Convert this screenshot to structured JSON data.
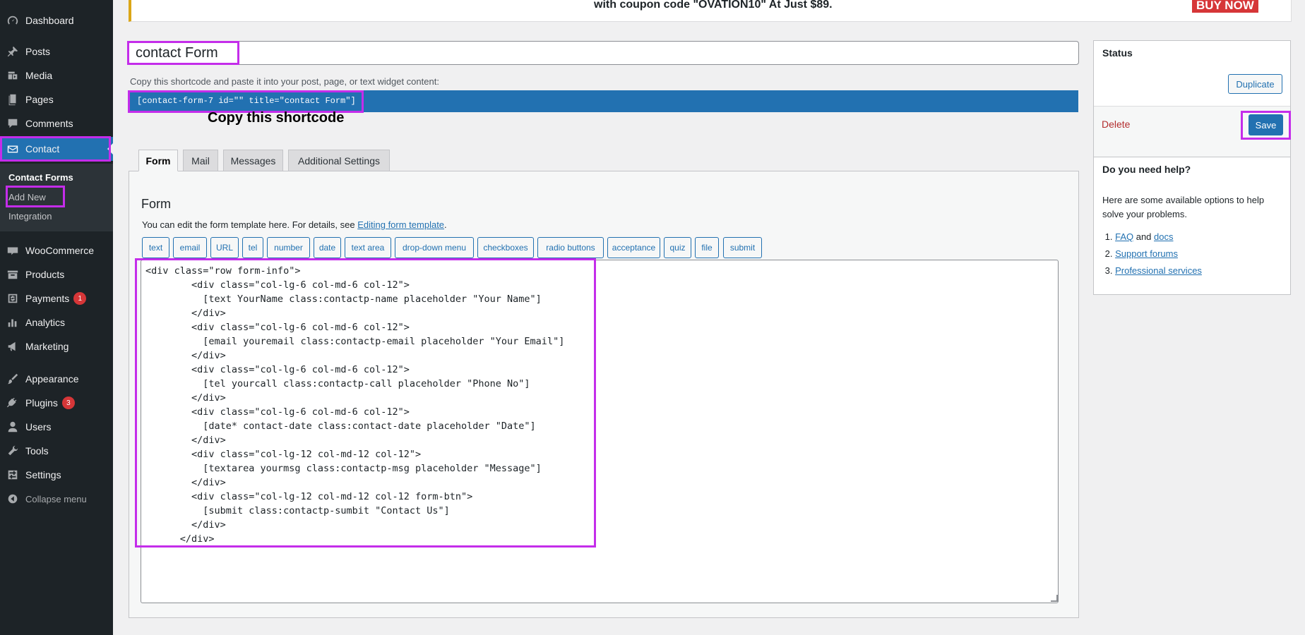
{
  "sidebar": {
    "items": [
      {
        "label": "Dashboard",
        "icon": "dashboard-icon"
      },
      {
        "label": "Posts",
        "icon": "pin-icon"
      },
      {
        "label": "Media",
        "icon": "media-icon"
      },
      {
        "label": "Pages",
        "icon": "page-icon"
      },
      {
        "label": "Comments",
        "icon": "comment-icon"
      },
      {
        "label": "Contact",
        "icon": "envelope-icon"
      },
      {
        "label": "WooCommerce",
        "icon": "woo-icon"
      },
      {
        "label": "Products",
        "icon": "archive-icon"
      },
      {
        "label": "Payments",
        "icon": "dollar-icon",
        "badge": "1"
      },
      {
        "label": "Analytics",
        "icon": "bar-chart-icon"
      },
      {
        "label": "Marketing",
        "icon": "megaphone-icon"
      },
      {
        "label": "Appearance",
        "icon": "brush-icon"
      },
      {
        "label": "Plugins",
        "icon": "plug-icon",
        "badge": "3"
      },
      {
        "label": "Users",
        "icon": "user-icon"
      },
      {
        "label": "Tools",
        "icon": "wrench-icon"
      },
      {
        "label": "Settings",
        "icon": "settings-icon"
      }
    ],
    "submenu": [
      "Contact Forms",
      "Add New",
      "Integration"
    ],
    "collapse": "Collapse menu"
  },
  "banner": {
    "text": "with coupon code \"OVATION10\" At Just $89.",
    "buy": "BUY NOW"
  },
  "form_title": "contact Form",
  "shortcode_note": "Copy this shortcode and paste it into your post, page, or text widget content:",
  "shortcode": "[contact-form-7 id=\"\" title=\"contact Form\"]",
  "copy_label": "Copy this shortcode",
  "tabs": [
    "Form",
    "Mail",
    "Messages",
    "Additional Settings"
  ],
  "panel": {
    "title": "Form",
    "desc": "You can edit the form template here. For details, see ",
    "desc_link": "Editing form template",
    "desc_end": "."
  },
  "tag_buttons": [
    "text",
    "email",
    "URL",
    "tel",
    "number",
    "date",
    "text area",
    "drop-down menu",
    "checkboxes",
    "radio buttons",
    "acceptance",
    "quiz",
    "file",
    "submit"
  ],
  "code": "<div class=\"row form-info\">\n        <div class=\"col-lg-6 col-md-6 col-12\">\n          [text YourName class:contactp-name placeholder \"Your Name\"]\n        </div>\n        <div class=\"col-lg-6 col-md-6 col-12\">\n          [email youremail class:contactp-email placeholder \"Your Email\"]\n        </div>\n        <div class=\"col-lg-6 col-md-6 col-12\">\n          [tel yourcall class:contactp-call placeholder \"Phone No\"]\n        </div>\n        <div class=\"col-lg-6 col-md-6 col-12\">\n          [date* contact-date class:contact-date placeholder \"Date\"]\n        </div>\n        <div class=\"col-lg-12 col-md-12 col-12\">\n          [textarea yourmsg class:contactp-msg placeholder \"Message\"]\n        </div>\n        <div class=\"col-lg-12 col-md-12 col-12 form-btn\">\n          [submit class:contactp-sumbit \"Contact Us\"]\n        </div>\n      </div>",
  "status": {
    "title": "Status",
    "duplicate": "Duplicate",
    "delete": "Delete",
    "save": "Save"
  },
  "help": {
    "title": "Do you need help?",
    "text": "Here are some available options to help solve your problems.",
    "items": [
      {
        "num": "1.",
        "link": "FAQ",
        "mid": " and ",
        "link2": "docs"
      },
      {
        "num": "2.",
        "link": "Support forums"
      },
      {
        "num": "3.",
        "link": "Professional services"
      }
    ]
  },
  "colors": {
    "sidebar": "#1d2327",
    "accent": "#2271b1",
    "highlight": "#c42dea",
    "danger": "#d63638"
  }
}
